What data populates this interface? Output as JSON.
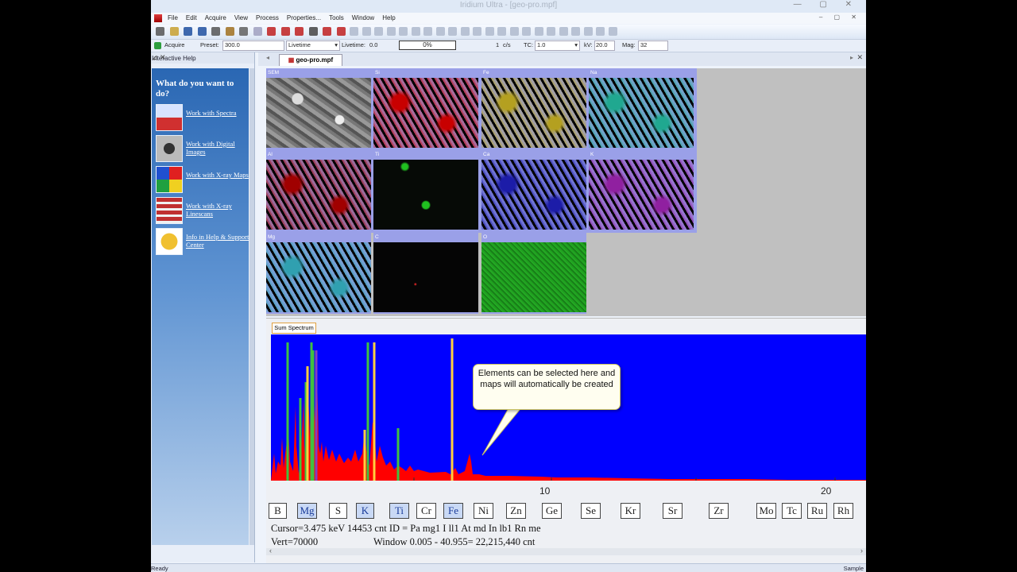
{
  "window": {
    "title": "Iridium Ultra - [geo-pro.mpf]",
    "controls": "— ▢ ✕"
  },
  "menu": [
    "File",
    "Edit",
    "Acquire",
    "View",
    "Process",
    "Properties...",
    "Tools",
    "Window",
    "Help"
  ],
  "acquire": {
    "acquire_label": "Acquire",
    "preset_label": "Preset:",
    "preset_value": "300.0",
    "mode_value": "Livetime",
    "livetime_label": "Livetime:",
    "livetime_value": "0.0",
    "progress": "0%",
    "rate_value": "1",
    "rate_unit": "c/s",
    "tc_label": "TC:",
    "tc_value": "1.0",
    "kv_label": "kV:",
    "kv_value": "20.0",
    "mag_label": "Mag:",
    "mag_value": "32"
  },
  "help": {
    "panel_title": "Interactive Help",
    "heading": "What do you want to do?",
    "items": [
      {
        "label": "Work with Spectra",
        "icon": "spectra-icon"
      },
      {
        "label": "Work with Digital Images",
        "icon": "camera-icon"
      },
      {
        "label": "Work with X-ray Maps",
        "icon": "xray-maps-icon"
      },
      {
        "label": "Work with X-ray Linescans",
        "icon": "linescan-icon"
      },
      {
        "label": "Info in Help & Support Center",
        "icon": "shield-icon"
      }
    ]
  },
  "document": {
    "tab": "geo-pro.mpf"
  },
  "maps": [
    {
      "label": "SEM",
      "color": "#9a9a9a"
    },
    {
      "label": "Si",
      "color": "#c80000"
    },
    {
      "label": "Fe",
      "color": "#b4a020"
    },
    {
      "label": "Na",
      "color": "#20a890"
    },
    {
      "label": "Al",
      "color": "#a00000"
    },
    {
      "label": "Ti",
      "color": "#20c020"
    },
    {
      "label": "Ca",
      "color": "#1c1ca8"
    },
    {
      "label": "K",
      "color": "#9020a0"
    },
    {
      "label": "Mg",
      "color": "#30a0b0"
    },
    {
      "label": "C",
      "color": "#c02020"
    },
    {
      "label": "O",
      "color": "#20a020"
    }
  ],
  "spectrum": {
    "tab": "Sum Spectrum",
    "x_ticks": [
      "10",
      "20"
    ],
    "elements": [
      {
        "sym": "B",
        "sel": false
      },
      {
        "sym": "Mg",
        "sel": true
      },
      {
        "sym": "S",
        "sel": false
      },
      {
        "sym": "K",
        "sel": true
      },
      {
        "sym": "Ti",
        "sel": true
      },
      {
        "sym": "Cr",
        "sel": false
      },
      {
        "sym": "Fe",
        "sel": true
      },
      {
        "sym": "Ni",
        "sel": false
      },
      {
        "sym": "Zn",
        "sel": false
      },
      {
        "sym": "Ge",
        "sel": false
      },
      {
        "sym": "Se",
        "sel": false
      },
      {
        "sym": "Kr",
        "sel": false
      },
      {
        "sym": "Sr",
        "sel": false
      },
      {
        "sym": "Zr",
        "sel": false
      },
      {
        "sym": "Mo",
        "sel": false
      },
      {
        "sym": "Tc",
        "sel": false
      },
      {
        "sym": "Ru",
        "sel": false
      },
      {
        "sym": "Rh",
        "sel": false
      }
    ],
    "info_line1": "Cursor=3.475 keV   14453 cnt   ID = Pa mg1  I ll1   At md   In lb1  Rn me",
    "info_vert": "Vert=70000",
    "info_window": "Window 0.005 - 40.955=    22,215,440 cnt"
  },
  "callout": {
    "text": "Elements can be selected here and maps will automatically be created"
  },
  "status": {
    "left": "Ready",
    "right": "Sample"
  }
}
